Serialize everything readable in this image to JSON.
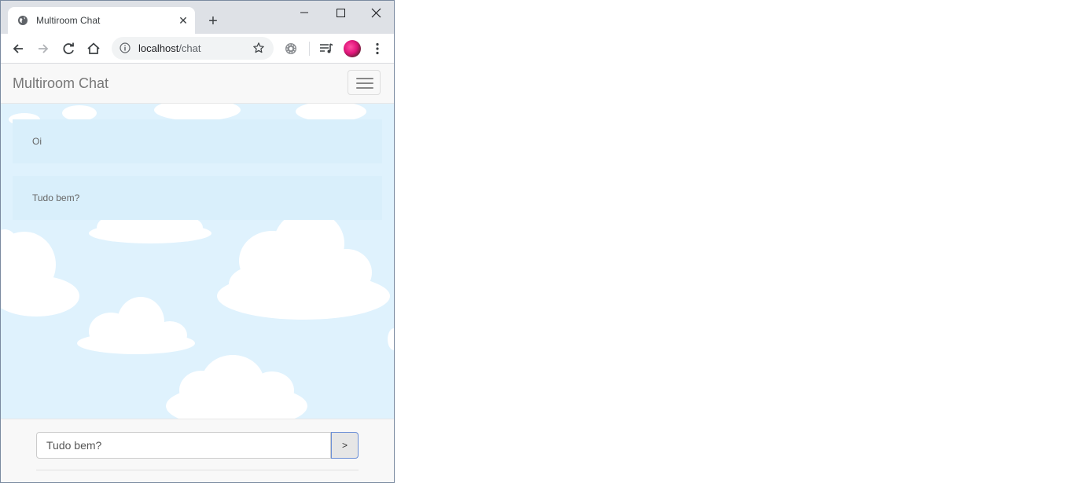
{
  "browser": {
    "tab": {
      "title": "Multiroom Chat",
      "favicon": "globe-icon",
      "close": "✕"
    },
    "new_tab": "+",
    "window_controls": [
      "minimize-icon",
      "maximize-icon",
      "close-icon"
    ],
    "toolbar": {
      "back": "back-arrow-icon",
      "forward": "forward-arrow-icon",
      "reload": "reload-icon",
      "home": "home-icon",
      "url_host": "localhost",
      "url_path": "/chat",
      "bookmark": "star-icon",
      "extension": "gear-icon",
      "media": "media-queue-icon",
      "menu": "kebab-menu-icon"
    }
  },
  "app": {
    "brand": "Multiroom Chat",
    "nav_toggle": "hamburger-icon",
    "messages": [
      {
        "text": "Oi"
      },
      {
        "text": "Tudo bem?"
      }
    ],
    "composer": {
      "value": "Tudo bem?",
      "send_label": ">"
    }
  },
  "colors": {
    "sky": "#dff2fd",
    "message_bg": "#d9effb",
    "navbar_bg": "#f8f8f8",
    "tabstrip_bg": "#dee1e6"
  }
}
